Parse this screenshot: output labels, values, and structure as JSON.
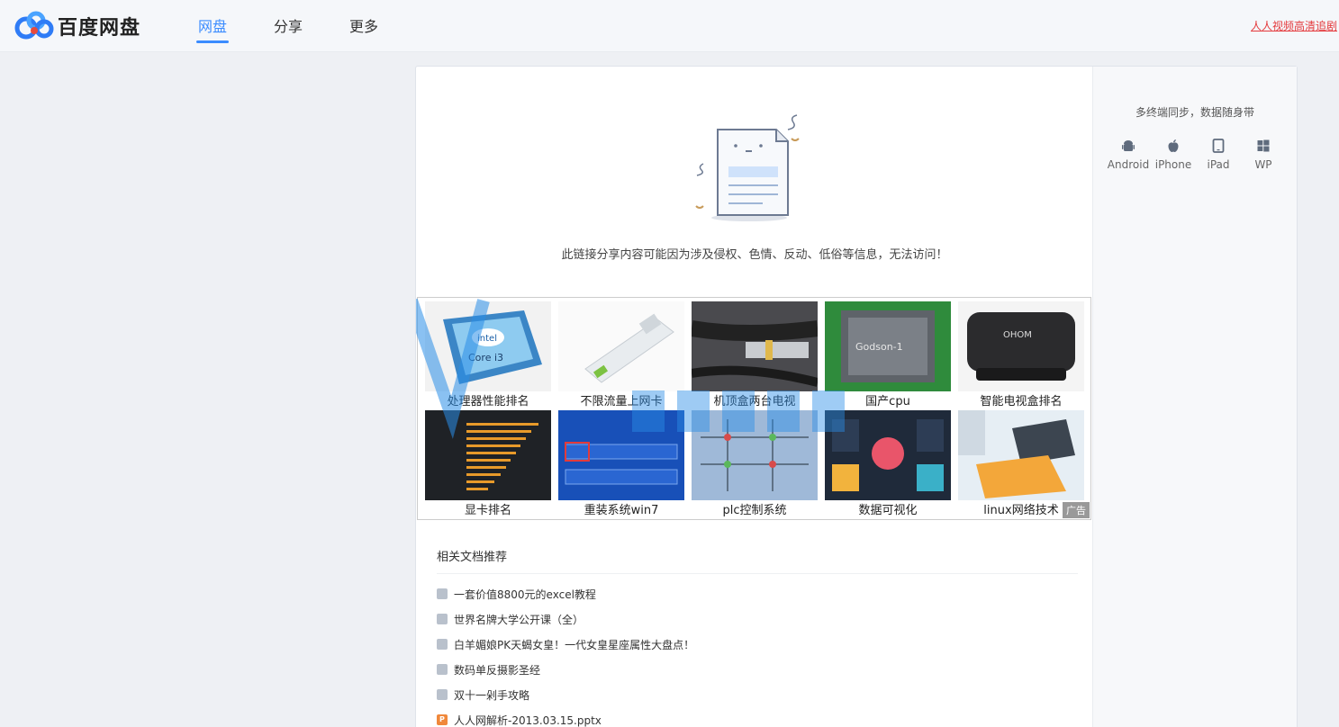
{
  "header": {
    "logo_text": "百度网盘",
    "nav": [
      {
        "label": "网盘",
        "active": true
      },
      {
        "label": "分享",
        "active": false
      },
      {
        "label": "更多",
        "active": false
      }
    ],
    "promo_link": "人人视频高清追剧"
  },
  "main": {
    "notice": "此链接分享内容可能因为涉及侵权、色情、反动、低俗等信息，无法访问！",
    "ad": {
      "items": [
        {
          "label": "处理器性能排名",
          "image": "cpu-chip"
        },
        {
          "label": "不限流量上网卡",
          "image": "usb-modem"
        },
        {
          "label": "机顶盒两台电视",
          "image": "cables"
        },
        {
          "label": "国产cpu",
          "image": "circuit-board"
        },
        {
          "label": "智能电视盒排名",
          "image": "tv-box"
        },
        {
          "label": "显卡排名",
          "image": "gpu-chart"
        },
        {
          "label": "重装系统win7",
          "image": "bios-screen"
        },
        {
          "label": "plc控制系统",
          "image": "plc-diagram"
        },
        {
          "label": "数据可视化",
          "image": "dashboard"
        },
        {
          "label": "linux网络技术",
          "image": "laptop-desk"
        }
      ],
      "tag": "广告"
    },
    "related": {
      "title": "相关文档推荐",
      "docs": [
        {
          "title": "一套价值8800元的excel教程",
          "type": "doc"
        },
        {
          "title": "世界名牌大学公开课（全）",
          "type": "doc"
        },
        {
          "title": "白羊媚娘PK天蝎女皇！一代女皇星座属性大盘点！",
          "type": "doc"
        },
        {
          "title": "数码单反摄影圣经",
          "type": "doc"
        },
        {
          "title": "双十一剁手攻略",
          "type": "doc"
        },
        {
          "title": "人人网解析-2013.03.15.pptx",
          "type": "ppt"
        }
      ],
      "ppt_glyph": "P"
    }
  },
  "sidebar": {
    "sync_title": "多终端同步，数据随身带",
    "platforms": [
      {
        "label": "Android",
        "icon": "android-icon"
      },
      {
        "label": "iPhone",
        "icon": "apple-icon"
      },
      {
        "label": "iPad",
        "icon": "ipad-icon"
      },
      {
        "label": "WP",
        "icon": "windows-icon"
      }
    ]
  },
  "colors": {
    "accent": "#3b8cff",
    "promo": "#e4393c",
    "watermark": "#2a8ee8"
  }
}
